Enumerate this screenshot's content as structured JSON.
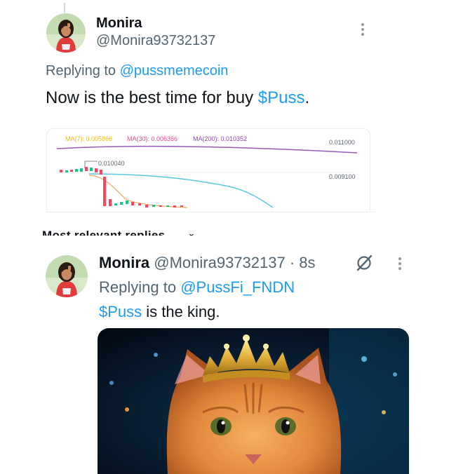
{
  "top_tweet": {
    "display_name": "Monira",
    "handle": "@Monira93732137",
    "replying_prefix": "Replying to ",
    "replying_to": "@pussmemecoin",
    "text_before": "Now is the best time for buy ",
    "cashtag": "$Puss",
    "text_after": ".",
    "avatar_icon": "profile-photo",
    "more_icon": "more-vertical-icon"
  },
  "chart_data": {
    "type": "line",
    "indicators": [
      {
        "name": "MA(7)",
        "value": "0.005866",
        "color": "#f0b90b"
      },
      {
        "name": "MA(30)",
        "value": "0.006366",
        "color": "#e84393"
      },
      {
        "name": "MA(200)",
        "value": "0.010352",
        "color": "#8e44ad"
      }
    ],
    "label_ma7": "MA(7): 0.005866",
    "label_ma30": "MA(30): 0.006366",
    "label_ma200": "MA(200): 0.010352",
    "price_ticks": [
      "0.011000",
      "0.009100"
    ],
    "high_annotation": "0.010040",
    "colors": {
      "up": "#0ecb81",
      "down": "#f6465d",
      "ma200": "#9b59b6",
      "ma_cyan": "#5bc8dc",
      "ma_orange": "#f3a55c"
    }
  },
  "sort_label": "Most relevant replies",
  "reply_tweet": {
    "display_name": "Monira",
    "handle": "@Monira93732137",
    "separator": " · ",
    "time": "8s",
    "replying_prefix": "Replying to ",
    "replying_to": "@PussFi_FNDN",
    "cashtag": "$Puss",
    "text_after": " is the king.",
    "grok_icon": "grok-icon",
    "more_icon": "more-vertical-icon",
    "media": "crowned-cat-image"
  },
  "colors": {
    "link": "#1d9bf0",
    "secondary": "#536471",
    "primary": "#0f1419"
  }
}
